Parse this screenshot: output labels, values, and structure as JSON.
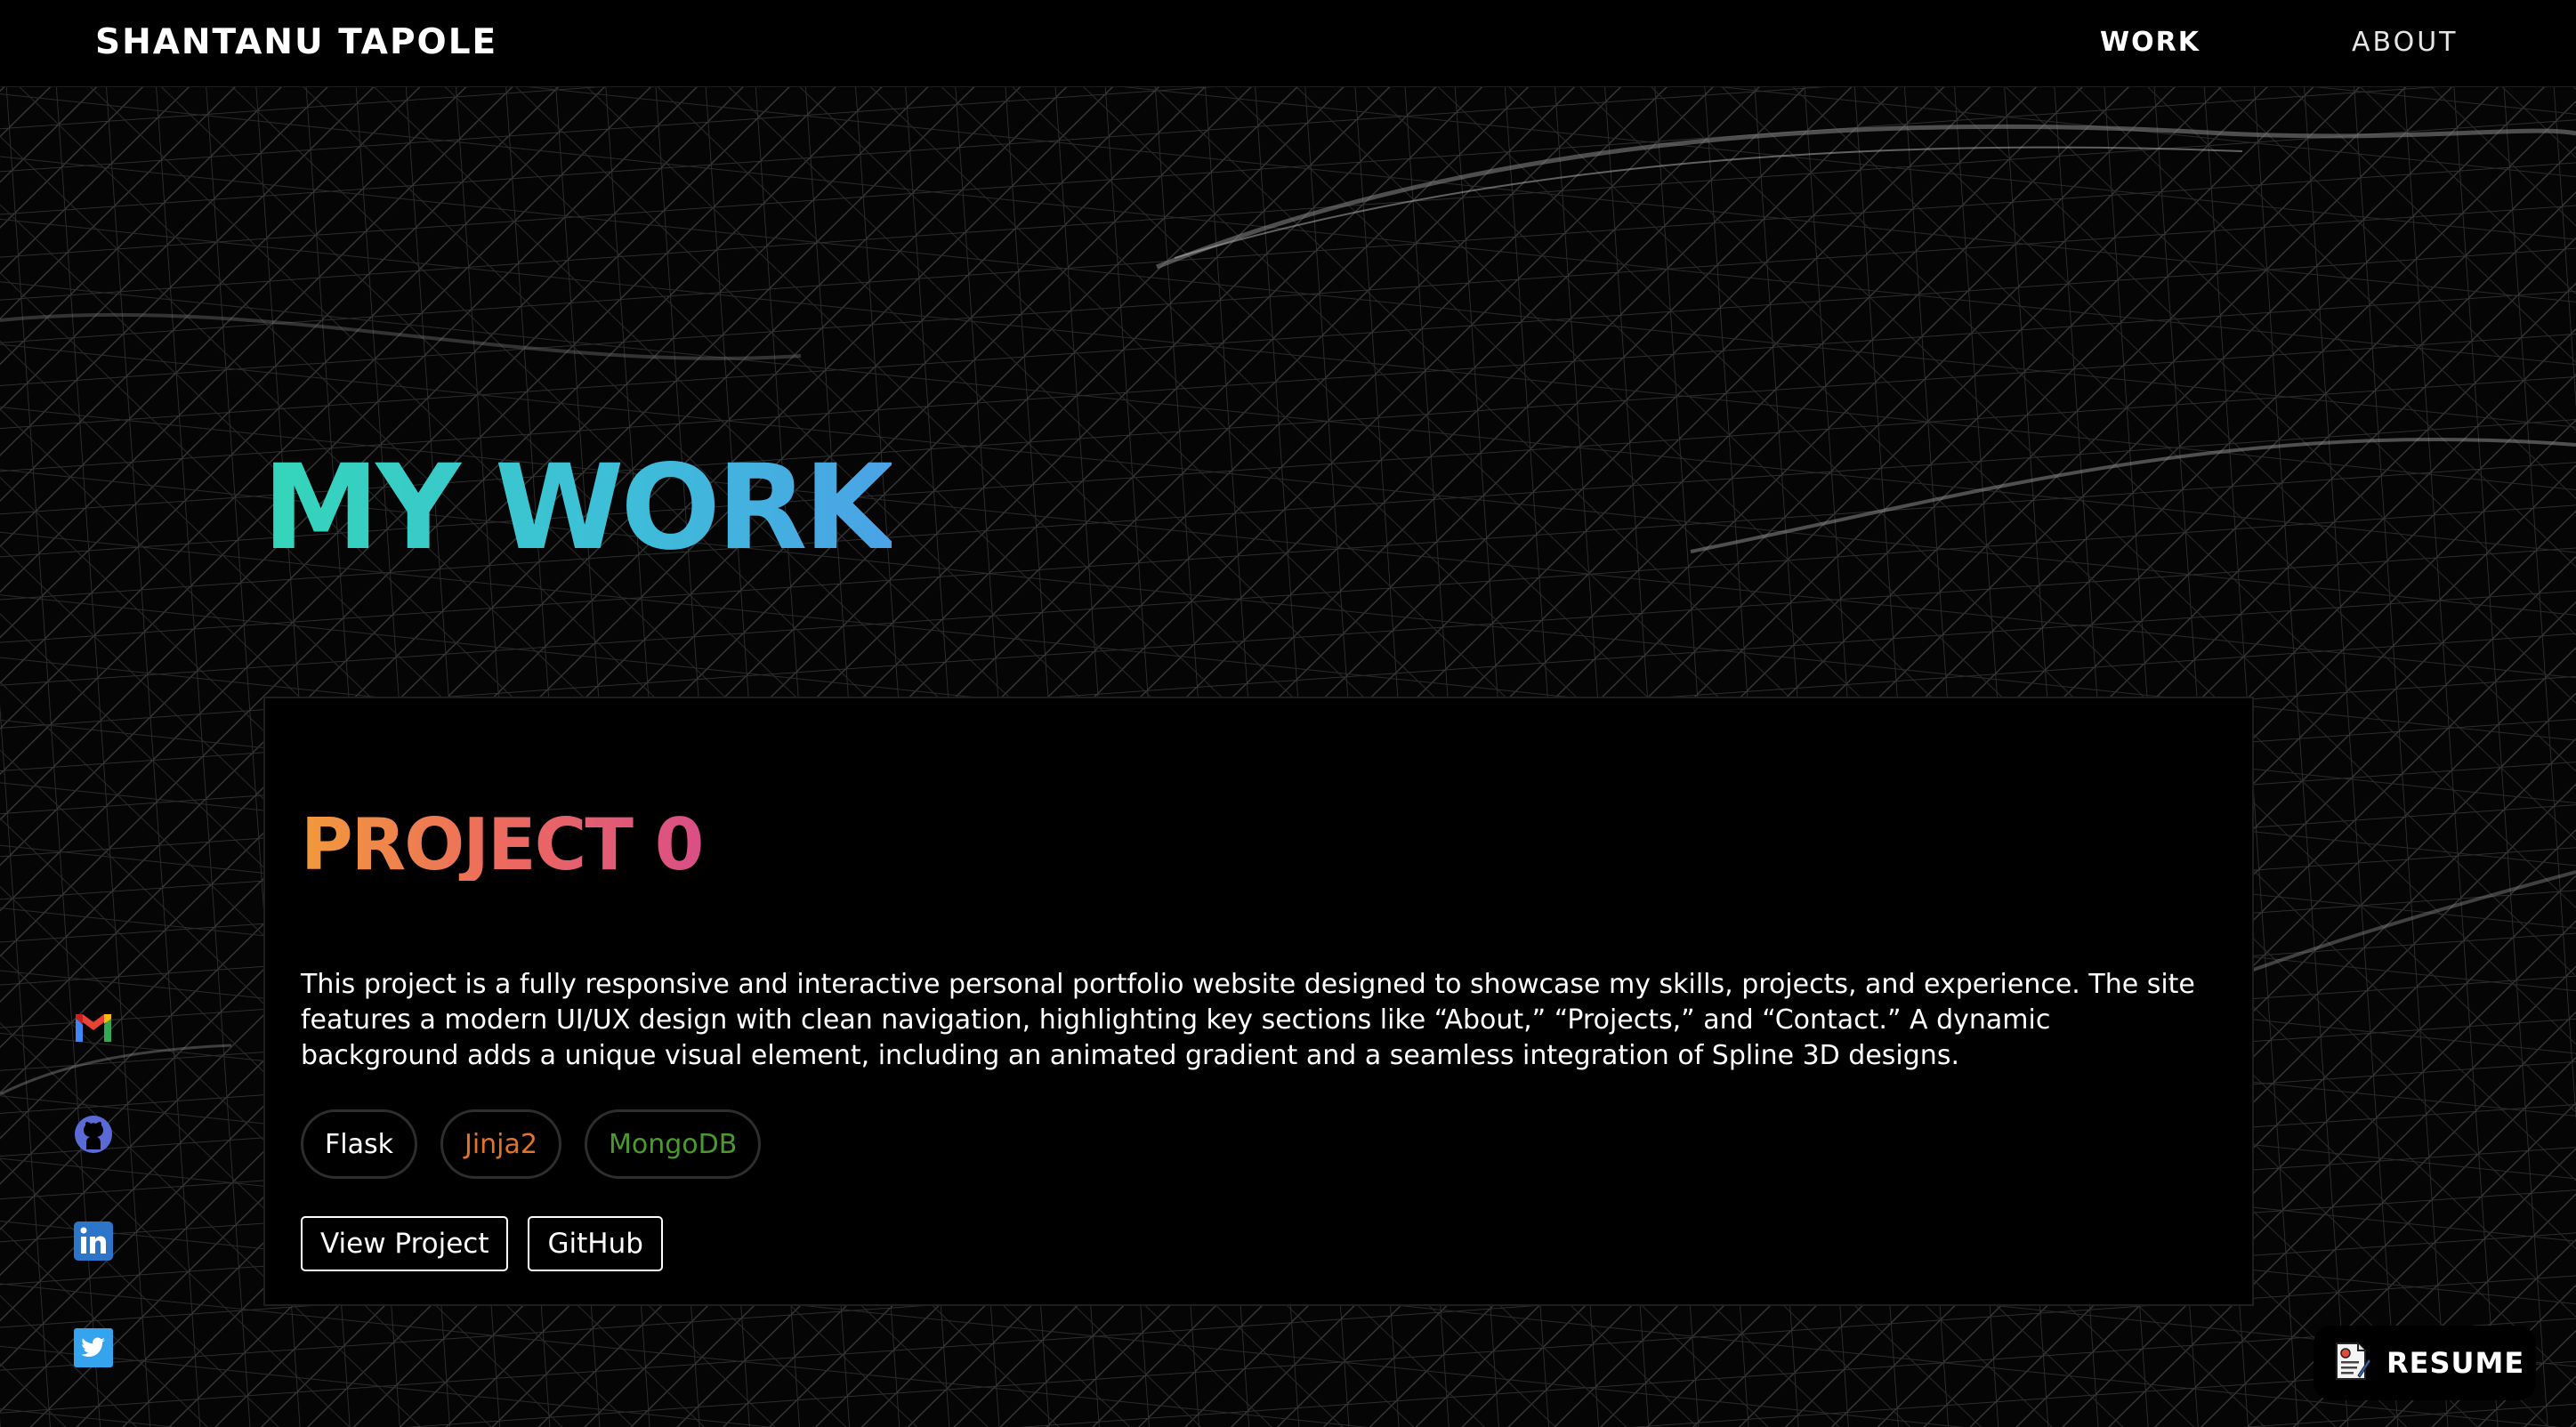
{
  "header": {
    "brand": "SHANTANU TAPOLE",
    "nav": [
      {
        "label": "WORK",
        "active": true
      },
      {
        "label": "ABOUT",
        "active": false
      }
    ]
  },
  "main": {
    "heading": "MY WORK",
    "project": {
      "title": "PROJECT 0",
      "description": "This project is a fully responsive and interactive personal portfolio website designed to showcase my skills, projects, and experience. The site features a modern UI/UX design with clean navigation, highlighting key sections like “About,” “Projects,” and “Contact.” A dynamic background adds a unique visual element, including an animated gradient and a seamless integration of Spline 3D designs.",
      "tags": [
        {
          "label": "Flask",
          "color": "#ffffff"
        },
        {
          "label": "Jinja2",
          "color": "#e2732a"
        },
        {
          "label": "MongoDB",
          "color": "#4a9a2e"
        }
      ],
      "actions": {
        "view_label": "View Project",
        "github_label": "GitHub"
      }
    }
  },
  "social": {
    "icons": [
      "gmail-icon",
      "github-icon",
      "linkedin-icon",
      "twitter-icon"
    ]
  },
  "resume": {
    "label": "RESUME",
    "icon": "resume-document-icon"
  },
  "colors": {
    "heading_gradient": [
      "#34d6b9",
      "#4aa3e6"
    ],
    "project_title_gradient": [
      "#f29a3c",
      "#d94f86"
    ],
    "background": "#050505"
  }
}
